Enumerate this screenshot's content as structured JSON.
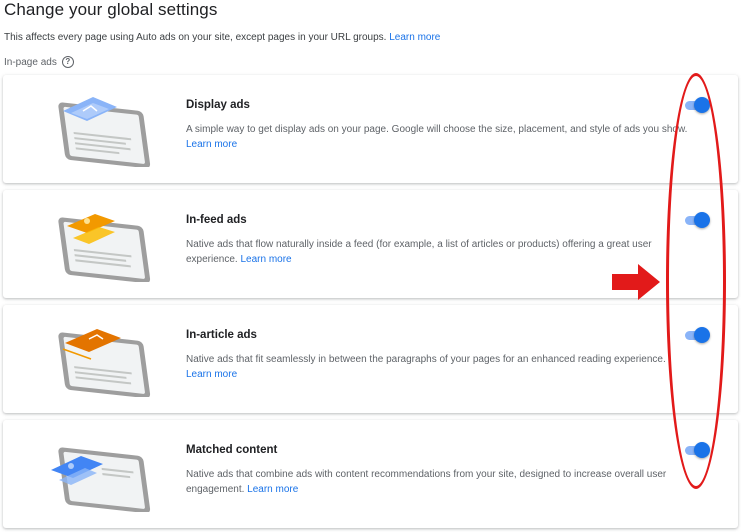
{
  "header": {
    "title": "Change your global settings",
    "subtitle": "This affects every page using Auto ads on your site, except pages in your URL groups.",
    "learn_more": "Learn more"
  },
  "section": {
    "label": "In-page ads",
    "help_icon": "help-circle-icon"
  },
  "cards": [
    {
      "title": "Display ads",
      "description": "A simple way to get display ads on your page. Google will choose the size, placement, and style of ads you show.",
      "learn_more": "Learn more",
      "enabled": true,
      "accent": "#8ab4f8"
    },
    {
      "title": "In-feed ads",
      "description": "Native ads that flow naturally inside a feed (for example, a list of articles or products) offering a great user experience.",
      "learn_more": "Learn more",
      "enabled": true,
      "accent": "#f29900"
    },
    {
      "title": "In-article ads",
      "description": "Native ads that fit seamlessly in between the paragraphs of your pages for an enhanced reading experience.",
      "learn_more": "Learn more",
      "enabled": true,
      "accent": "#e37400"
    },
    {
      "title": "Matched content",
      "description": "Native ads that combine ads with content recommendations from your site, designed to increase overall user engagement.",
      "learn_more": "Learn more",
      "enabled": true,
      "accent": "#4285f4"
    }
  ],
  "colors": {
    "toggle_on": "#1a73e8",
    "toggle_track": "#8ab4f8",
    "annotation": "#e21a1a"
  }
}
